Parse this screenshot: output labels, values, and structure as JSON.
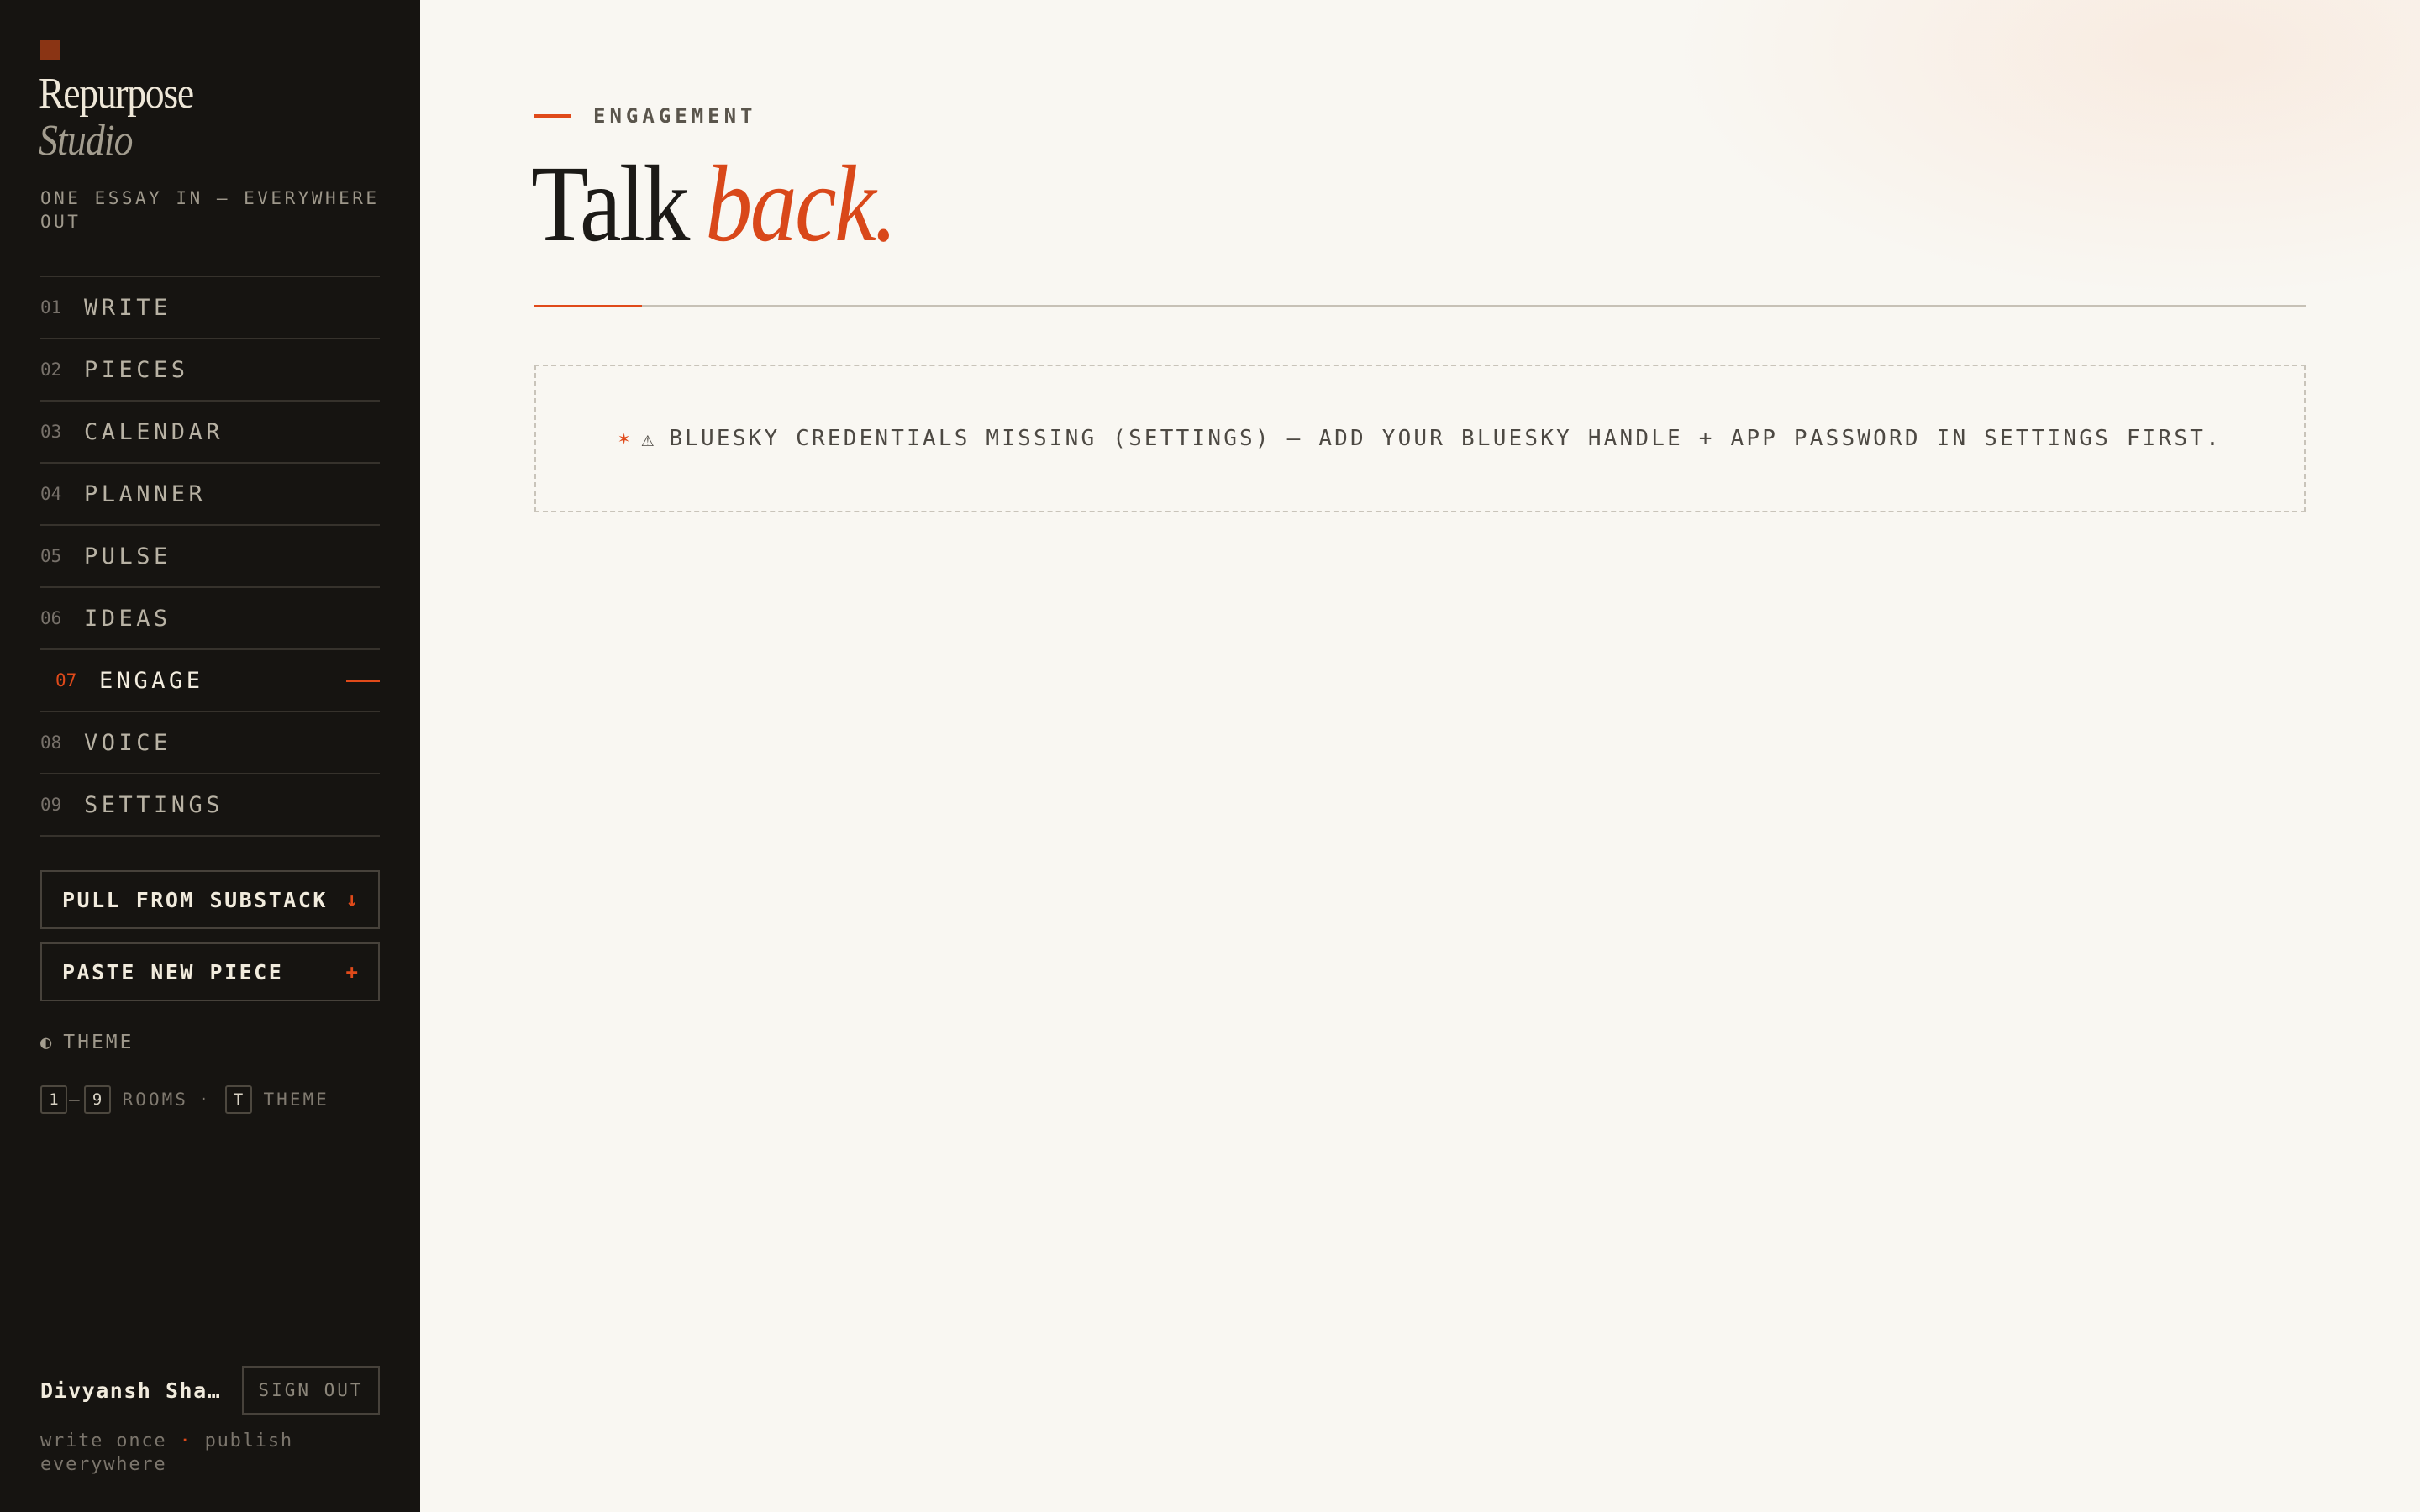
{
  "sidebar": {
    "brand": {
      "line1": "Repurpose",
      "line2": "Studio"
    },
    "tagline": "ONE ESSAY IN — EVERYWHERE OUT",
    "nav": [
      {
        "num": "01",
        "label": "WRITE"
      },
      {
        "num": "02",
        "label": "PIECES"
      },
      {
        "num": "03",
        "label": "CALENDAR"
      },
      {
        "num": "04",
        "label": "PLANNER"
      },
      {
        "num": "05",
        "label": "PULSE"
      },
      {
        "num": "06",
        "label": "IDEAS"
      },
      {
        "num": "07",
        "label": "ENGAGE",
        "active": true
      },
      {
        "num": "08",
        "label": "VOICE"
      },
      {
        "num": "09",
        "label": "SETTINGS"
      }
    ],
    "actions": {
      "pull": {
        "label": "PULL FROM SUBSTACK",
        "glyph": "↓"
      },
      "paste": {
        "label": "PASTE NEW PIECE",
        "glyph": "+"
      }
    },
    "theme": {
      "icon": "half-circle-icon",
      "label": "THEME"
    },
    "shortcuts": {
      "key_from": "1",
      "key_to": "9",
      "rooms_label": "ROOMS",
      "separator": "·",
      "theme_key": "T",
      "theme_label": "THEME"
    },
    "user": {
      "name": "Divyansh Shar…",
      "signout_label": "SIGN OUT"
    },
    "footer": {
      "part1": "write once",
      "dot": "·",
      "part2": "publish everywhere"
    }
  },
  "main": {
    "eyebrow": "ENGAGEMENT",
    "title": {
      "plain": "Talk",
      "accent": "back."
    },
    "notice": {
      "star": "✶",
      "icon": "warning-icon",
      "icon_glyph": "⚠",
      "text": "BLUESKY CREDENTIALS MISSING (SETTINGS) — ADD YOUR BLUESKY HANDLE + APP PASSWORD IN SETTINGS FIRST."
    }
  },
  "colors": {
    "accent": "#e04a1a",
    "sidebar_bg": "#161411",
    "main_bg": "#f9f7f2"
  }
}
